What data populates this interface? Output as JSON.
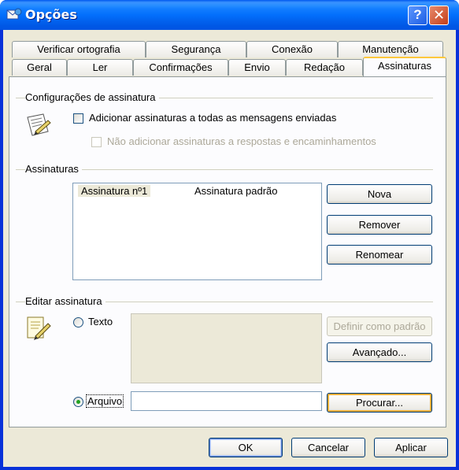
{
  "window": {
    "title": "Opções"
  },
  "titlebar_buttons": {
    "help": "?",
    "close": "✕"
  },
  "tabs_row1": [
    "Verificar ortografia",
    "Segurança",
    "Conexão",
    "Manutenção"
  ],
  "tabs_row2": [
    "Geral",
    "Ler",
    "Confirmações",
    "Envio",
    "Redação",
    "Assinaturas"
  ],
  "active_tab": "Assinaturas",
  "settings_group": {
    "title": "Configurações de assinatura",
    "add_all": "Adicionar assinaturas a todas as mensagens enviadas",
    "add_all_checked": false,
    "no_replies": "Não adicionar assinaturas a respostas e encaminhamentos",
    "no_replies_checked": false
  },
  "signatures_group": {
    "title": "Assinaturas",
    "rows": [
      {
        "name": "Assinatura nº1",
        "status": "Assinatura padrão"
      }
    ],
    "new_button": "Nova",
    "remove_button": "Remover",
    "rename_button": "Renomear"
  },
  "edit_group": {
    "title": "Editar assinatura",
    "text_option": "Texto",
    "file_option": "Arquivo",
    "selected_option": "Arquivo",
    "text_value": "",
    "file_value": "",
    "set_default_button": "Definir como padrão",
    "advanced_button": "Avançado...",
    "browse_button": "Procurar..."
  },
  "footer": {
    "ok": "OK",
    "cancel": "Cancelar",
    "apply": "Aplicar"
  },
  "icons": {
    "app": "outlook-express-icon",
    "settings": "signature-settings-icon",
    "edit": "signature-edit-icon"
  }
}
